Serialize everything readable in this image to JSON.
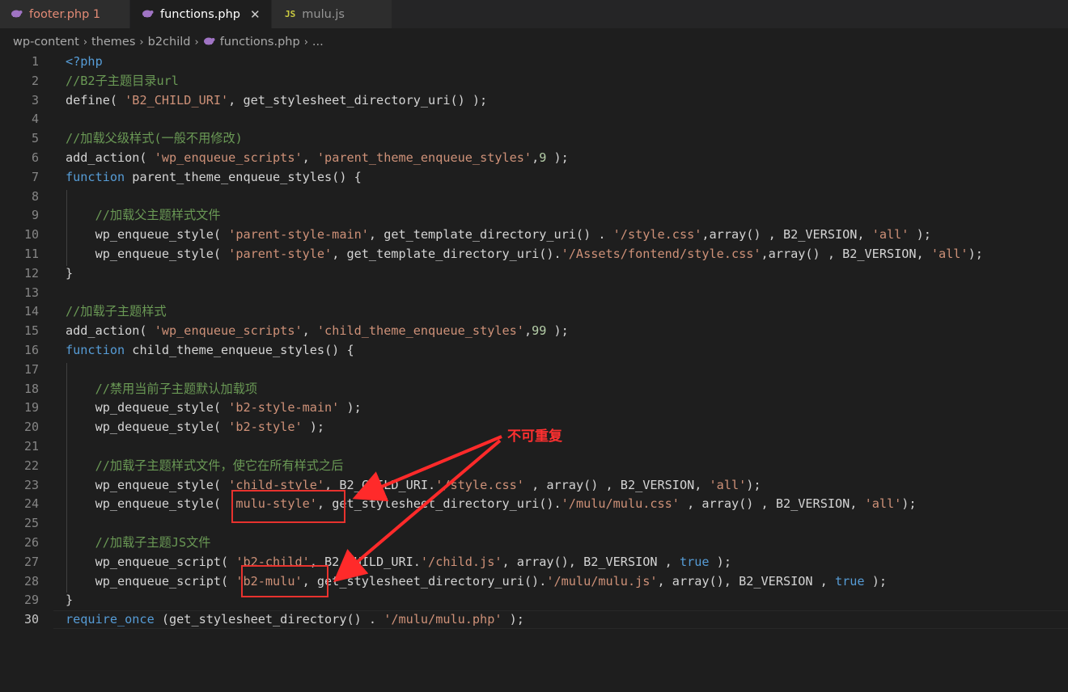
{
  "tabs": [
    {
      "label": "footer.php 1",
      "icon": "php-elephant-icon",
      "active": false
    },
    {
      "label": "functions.php",
      "icon": "php-elephant-icon",
      "active": true,
      "close": "✕"
    },
    {
      "label": "mulu.js",
      "icon": "js-icon",
      "icon_text": "JS",
      "active": false
    }
  ],
  "breadcrumb": {
    "items": [
      "wp-content",
      "themes",
      "b2child",
      "functions.php",
      "..."
    ],
    "separator": "›"
  },
  "editor": {
    "language": "php",
    "current_line": 30,
    "lines": [
      {
        "num": "1",
        "text": "<?php"
      },
      {
        "num": "2",
        "text": "//B2子主题目录url"
      },
      {
        "num": "3",
        "text": "define( 'B2_CHILD_URI', get_stylesheet_directory_uri() );"
      },
      {
        "num": "4",
        "text": ""
      },
      {
        "num": "5",
        "text": "//加载父级样式(一般不用修改)"
      },
      {
        "num": "6",
        "text": "add_action( 'wp_enqueue_scripts', 'parent_theme_enqueue_styles',9 );"
      },
      {
        "num": "7",
        "text": "function parent_theme_enqueue_styles() {"
      },
      {
        "num": "8",
        "text": ""
      },
      {
        "num": "9",
        "text": "    //加载父主题样式文件"
      },
      {
        "num": "10",
        "text": "    wp_enqueue_style( 'parent-style-main', get_template_directory_uri() . '/style.css',array() , B2_VERSION, 'all' );"
      },
      {
        "num": "11",
        "text": "    wp_enqueue_style( 'parent-style', get_template_directory_uri().'/Assets/fontend/style.css',array() , B2_VERSION, 'all');"
      },
      {
        "num": "12",
        "text": "}"
      },
      {
        "num": "13",
        "text": ""
      },
      {
        "num": "14",
        "text": "//加载子主题样式"
      },
      {
        "num": "15",
        "text": "add_action( 'wp_enqueue_scripts', 'child_theme_enqueue_styles',99 );"
      },
      {
        "num": "16",
        "text": "function child_theme_enqueue_styles() {"
      },
      {
        "num": "17",
        "text": ""
      },
      {
        "num": "18",
        "text": "    //禁用当前子主题默认加载项"
      },
      {
        "num": "19",
        "text": "    wp_dequeue_style( 'b2-style-main' );"
      },
      {
        "num": "20",
        "text": "    wp_dequeue_style( 'b2-style' );"
      },
      {
        "num": "21",
        "text": ""
      },
      {
        "num": "22",
        "text": "    //加载子主题样式文件，使它在所有样式之后"
      },
      {
        "num": "23",
        "text": "    wp_enqueue_style( 'child-style', B2_CHILD_URI.'/style.css' , array() , B2_VERSION, 'all');"
      },
      {
        "num": "24",
        "text": "    wp_enqueue_style( 'mulu-style', get_stylesheet_directory_uri().'/mulu/mulu.css' , array() , B2_VERSION, 'all');"
      },
      {
        "num": "25",
        "text": ""
      },
      {
        "num": "26",
        "text": "    //加载子主题JS文件"
      },
      {
        "num": "27",
        "text": "    wp_enqueue_script( 'b2-child', B2_CHILD_URI.'/child.js', array(), B2_VERSION , true );"
      },
      {
        "num": "28",
        "text": "    wp_enqueue_script( 'b2-mulu', get_stylesheet_directory_uri().'/mulu/mulu.js', array(), B2_VERSION , true );"
      },
      {
        "num": "29",
        "text": "}"
      },
      {
        "num": "30",
        "text": "require_once (get_stylesheet_directory() . '/mulu/mulu.php' );"
      }
    ]
  },
  "annotation": {
    "text": "不可重复",
    "color": "#ff3030",
    "highlights": [
      "'mulu-style',",
      "'b2-mulu',"
    ]
  },
  "colors": {
    "background": "#1e1e1e",
    "keyword": "#569cd6",
    "string": "#ce9178",
    "comment": "#6a9955",
    "number": "#b5cea8",
    "text": "#d4d4d4"
  }
}
